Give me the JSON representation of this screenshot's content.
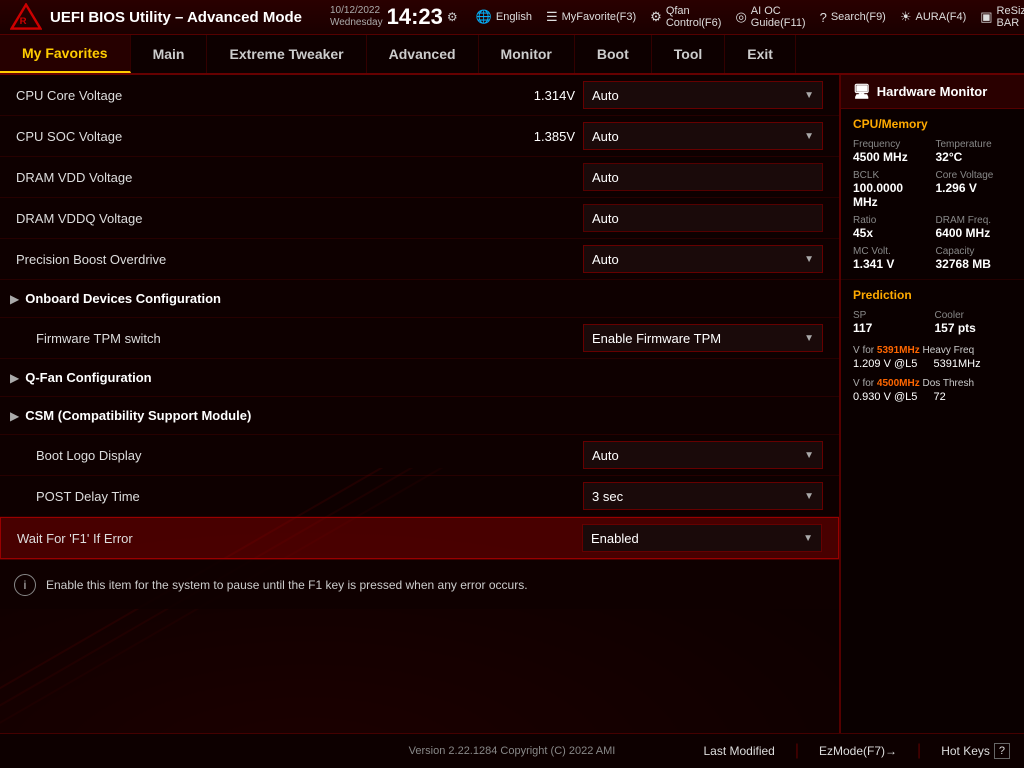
{
  "topbar": {
    "title": "UEFI BIOS Utility – Advanced Mode",
    "date": "10/12/2022\nWednesday",
    "time": "14:23",
    "gear": "⚙",
    "items": [
      {
        "label": "English",
        "icon": "🌐"
      },
      {
        "label": "MyFavorite(F3)",
        "icon": "☰"
      },
      {
        "label": "Qfan Control(F6)",
        "icon": "⚙"
      },
      {
        "label": "AI OC Guide(F11)",
        "icon": "◎"
      },
      {
        "label": "Search(F9)",
        "icon": "?"
      },
      {
        "label": "AURA(F4)",
        "icon": "☀"
      },
      {
        "label": "ReSize BAR",
        "icon": "▣"
      }
    ]
  },
  "nav": {
    "tabs": [
      {
        "label": "My Favorites",
        "active": true
      },
      {
        "label": "Main",
        "active": false
      },
      {
        "label": "Extreme Tweaker",
        "active": false
      },
      {
        "label": "Advanced",
        "active": false
      },
      {
        "label": "Monitor",
        "active": false
      },
      {
        "label": "Boot",
        "active": false
      },
      {
        "label": "Tool",
        "active": false
      },
      {
        "label": "Exit",
        "active": false
      }
    ]
  },
  "settings": [
    {
      "type": "row",
      "label": "CPU Core Voltage",
      "valueStatic": "1.314V",
      "dropdown": "Auto",
      "hasArrow": true
    },
    {
      "type": "row",
      "label": "CPU SOC Voltage",
      "valueStatic": "1.385V",
      "dropdown": "Auto",
      "hasArrow": true
    },
    {
      "type": "row",
      "label": "DRAM VDD Voltage",
      "valueStatic": "",
      "dropdown": "Auto",
      "hasArrow": false
    },
    {
      "type": "row",
      "label": "DRAM VDDQ Voltage",
      "valueStatic": "",
      "dropdown": "Auto",
      "hasArrow": false
    },
    {
      "type": "row",
      "label": "Precision Boost Overdrive",
      "valueStatic": "",
      "dropdown": "Auto",
      "hasArrow": true
    },
    {
      "type": "section",
      "label": "Onboard Devices Configuration"
    },
    {
      "type": "row",
      "label": "Firmware TPM switch",
      "valueStatic": "",
      "dropdown": "Enable Firmware TPM",
      "hasArrow": true,
      "indented": true
    },
    {
      "type": "section",
      "label": "Q-Fan Configuration"
    },
    {
      "type": "section",
      "label": "CSM (Compatibility Support Module)"
    },
    {
      "type": "row",
      "label": "Boot Logo Display",
      "valueStatic": "",
      "dropdown": "Auto",
      "hasArrow": true,
      "indented": true
    },
    {
      "type": "row",
      "label": "POST Delay Time",
      "valueStatic": "",
      "dropdown": "3 sec",
      "hasArrow": true,
      "indented": true
    },
    {
      "type": "row",
      "label": "Wait For 'F1' If Error",
      "valueStatic": "",
      "dropdown": "Enabled",
      "hasArrow": true,
      "selected": true
    }
  ],
  "infobar": {
    "icon": "i",
    "text": "Enable this item for the system to pause until the F1 key is pressed when any error occurs."
  },
  "hwmonitor": {
    "title": "Hardware Monitor",
    "cpu_memory_title": "CPU/Memory",
    "items": [
      {
        "label": "Frequency",
        "value": "4500 MHz"
      },
      {
        "label": "Temperature",
        "value": "32°C"
      },
      {
        "label": "BCLK",
        "value": "100.0000 MHz"
      },
      {
        "label": "Core Voltage",
        "value": "1.296 V"
      },
      {
        "label": "Ratio",
        "value": "45x"
      },
      {
        "label": "DRAM Freq.",
        "value": "6400 MHz"
      },
      {
        "label": "MC Volt.",
        "value": "1.341 V"
      },
      {
        "label": "Capacity",
        "value": "32768 MB"
      }
    ],
    "prediction_title": "Prediction",
    "sp_label": "SP",
    "sp_value": "117",
    "cooler_label": "Cooler",
    "cooler_value": "157 pts",
    "freq1_label": "V for ",
    "freq1_mhz": "5391MHz",
    "freq1_type": "Heavy Freq",
    "freq1_volt": "1.209 V @L5",
    "freq1_val": "5391MHz",
    "freq2_label": "V for ",
    "freq2_mhz": "4500MHz",
    "freq2_type": "Dos Thresh",
    "freq2_volt": "0.930 V @L5",
    "freq2_val": "72"
  },
  "bottombar": {
    "last_modified": "Last Modified",
    "ez_mode": "EzMode(F7)→",
    "hot_keys": "Hot Keys",
    "hot_keys_icon": "?",
    "copyright": "Version 2.22.1284 Copyright (C) 2022 AMI"
  }
}
